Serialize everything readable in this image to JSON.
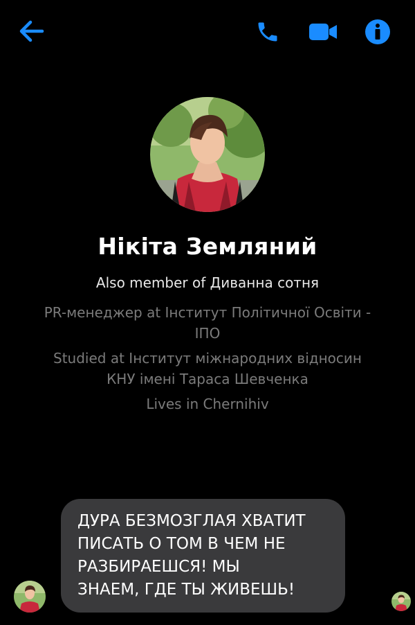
{
  "header": {
    "back_icon": "arrow-left-icon",
    "call_icon": "phone-icon",
    "video_icon": "video-camera-icon",
    "info_icon": "info-icon",
    "accent_color": "#1a8cff"
  },
  "profile": {
    "name": "Нікіта Земляний",
    "member_of": "Also member of Диванна сотня",
    "work_line1": "PR-менеджер at Інститут Політичної Освіти -",
    "work_line2": "ІПО",
    "study_line1": "Studied at Інститут міжнародних відносин",
    "study_line2": "КНУ імені Тараса Шевченка",
    "lives": "Lives in Chernihiv"
  },
  "conversation": {
    "messages": [
      {
        "direction": "incoming",
        "lines": [
          "ДУРА БЕЗМОЗГЛАЯ ХВАТИТ",
          "ПИСАТЬ О ТОМ В ЧЕМ НЕ",
          "РАЗБИРАЕШСЯ! МЫ",
          "ЗНАЕМ, ГДЕ ТЫ ЖИВЕШЬ!"
        ],
        "bubble_color": "#3a3a3c"
      }
    ]
  }
}
